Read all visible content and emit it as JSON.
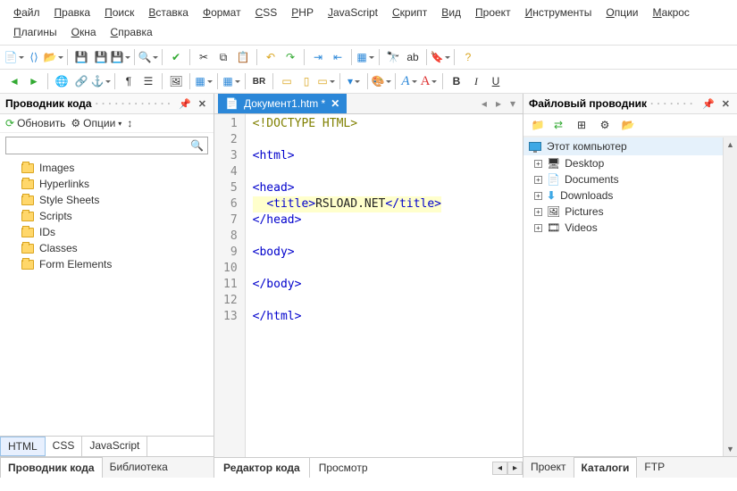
{
  "menu": [
    "Файл",
    "Правка",
    "Поиск",
    "Вставка",
    "Формат",
    "CSS",
    "PHP",
    "JavaScript",
    "Скрипт",
    "Вид",
    "Проект",
    "Инструменты",
    "Опции",
    "Макрос",
    "Плагины",
    "Окна",
    "Справка"
  ],
  "left_panel": {
    "title": "Проводник кода",
    "refresh": "Обновить",
    "options": "Опции",
    "search_placeholder": "",
    "items": [
      "Images",
      "Hyperlinks",
      "Style Sheets",
      "Scripts",
      "IDs",
      "Classes",
      "Form Elements"
    ],
    "lang_tabs": [
      "HTML",
      "CSS",
      "JavaScript"
    ],
    "lang_active": 0,
    "bottom_tabs": [
      "Проводник кода",
      "Библиотека"
    ],
    "bottom_active": 0
  },
  "editor": {
    "tab_label": "Документ1.htm *",
    "lines": [
      {
        "n": 1,
        "segs": [
          {
            "t": "<!DOCTYPE HTML>",
            "c": "t-olive"
          }
        ]
      },
      {
        "n": 2,
        "segs": []
      },
      {
        "n": 3,
        "segs": [
          {
            "t": "<html>",
            "c": "t-blue"
          }
        ]
      },
      {
        "n": 4,
        "segs": []
      },
      {
        "n": 5,
        "segs": [
          {
            "t": "<head>",
            "c": "t-blue"
          }
        ]
      },
      {
        "n": 6,
        "hl": true,
        "segs": [
          {
            "t": "  ",
            "c": ""
          },
          {
            "t": "<title>",
            "c": "t-blue"
          },
          {
            "t": "RSLOAD.NET",
            "c": "t-text"
          },
          {
            "t": "</title>",
            "c": "t-blue"
          }
        ]
      },
      {
        "n": 7,
        "segs": [
          {
            "t": "</head>",
            "c": "t-blue"
          }
        ]
      },
      {
        "n": 8,
        "segs": []
      },
      {
        "n": 9,
        "segs": [
          {
            "t": "<body>",
            "c": "t-blue"
          }
        ]
      },
      {
        "n": 10,
        "segs": []
      },
      {
        "n": 11,
        "segs": [
          {
            "t": "</body>",
            "c": "t-blue"
          }
        ]
      },
      {
        "n": 12,
        "segs": []
      },
      {
        "n": 13,
        "segs": [
          {
            "t": "</html>",
            "c": "t-blue"
          }
        ]
      }
    ],
    "bottom_tabs": [
      "Редактор кода",
      "Просмотр"
    ],
    "bottom_active": 0
  },
  "right_panel": {
    "title": "Файловый проводник",
    "root": "Этот компьютер",
    "items": [
      {
        "icon": "desktop",
        "label": "Desktop"
      },
      {
        "icon": "doc",
        "label": "Documents"
      },
      {
        "icon": "download",
        "label": "Downloads"
      },
      {
        "icon": "pic",
        "label": "Pictures"
      },
      {
        "icon": "video",
        "label": "Videos"
      }
    ],
    "bottom_tabs": [
      "Проект",
      "Каталоги",
      "FTP"
    ],
    "bottom_active": 1
  }
}
